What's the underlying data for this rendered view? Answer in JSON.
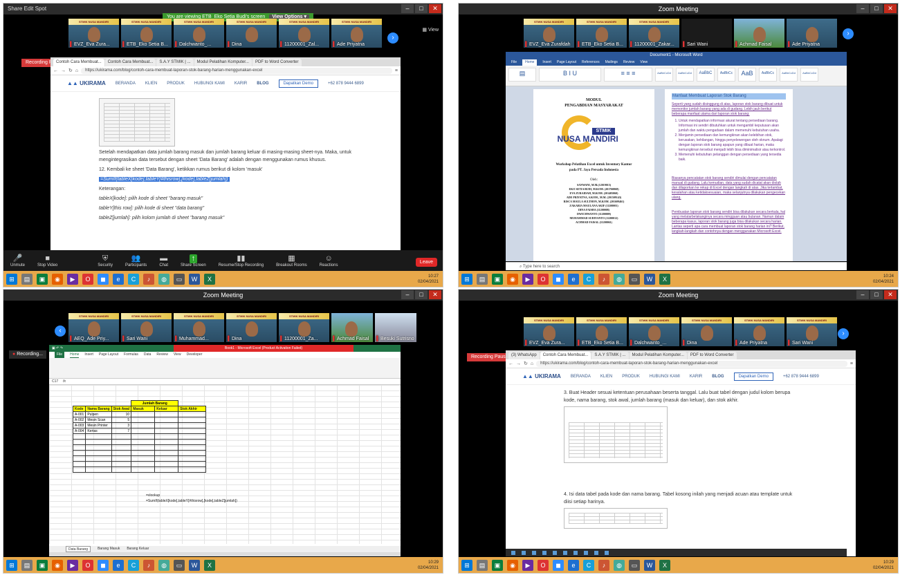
{
  "panel1": {
    "top_strip": "Share    Edit    Spot",
    "banner_text": "You are viewing ETB_Eko Setia Budi's screen",
    "view_options": "View Options ▾",
    "view_label": "View",
    "participants": [
      "EVZ_Eva Zura...",
      "ETB_Eko Setia B...",
      "Dalchwanto_...",
      "Dina",
      "11200001_Zal...",
      "Ade Priyatna"
    ],
    "recording": "Recording Paused",
    "tabs": [
      "Contoh Cara Membuat...",
      "Contoh Cara Membuat...",
      "S.A.Y STMIK | ...",
      "Modul Pelatihan Komputer...",
      "PDF to Word Converter"
    ],
    "address": "https://ukirama.com/blog/contoh-cara-membuat-laporan-stok-barang-harian-menggunakan-excel",
    "site": {
      "logo": "UKIRAMA",
      "nav": [
        "BERANDA",
        "KLIEN",
        "PRODUK",
        "HUBUNGI KAMI",
        "KARIR",
        "BLOG"
      ],
      "demo": "Dapatkan Demo",
      "phone": "+62 878 9444 6899"
    },
    "para1": "Setelah mendapatkan data jumlah barang masuk dan jumlah barang keluar di masing-masing sheet-nya. Maka, untuk mengintegrasikan data tersebut dengan sheet 'Data Barang' adalah dengan menggunakan rumus khusus.",
    "step12": "12. Kembali ke sheet 'Data Barang', ketikkan rumus berikut  di kolom 'masuk'",
    "formula": "=SumIf(tableX[kode],tableY[#thisrow],[kode],tableZ[jumlah])",
    "ket": "Keterangan:",
    "ket1": "tableX[kode]: pilih kode di sheet \"barang masuk\"",
    "ket2": "tableY[this row]: pilih kode di sheet \"data barang\"",
    "ket3": "tableZ[jumlah]: pilih kolom jumlah di sheet \"barang masuk\"",
    "controls": [
      "Unmute",
      "Stop Video",
      "Security",
      "Participants",
      "Chat",
      "Share Screen",
      "Resume/Stop Recording",
      "Breakout Rooms",
      "Reactions"
    ],
    "leave": "Leave",
    "clock": [
      "10:27",
      "02/04/2021"
    ]
  },
  "panel2": {
    "title": "Zoom Meeting",
    "participants": [
      "EVZ_Eva Zurafdah",
      "ETB_Eko Setia B...",
      "11200001_Zakar...",
      "Sari Wani",
      "Achmad Faisal",
      "Ade Priyatna"
    ],
    "doc_title": "Document1 - Microsoft Word",
    "ribbon_tabs": [
      "File",
      "Home",
      "Insert",
      "Page Layout",
      "References",
      "Mailings",
      "Review",
      "View"
    ],
    "styles": [
      "AaBbCcDd",
      "AaBbCcDd",
      "AaBbC",
      "AaBbCc",
      "AaB",
      "AaBbCc",
      "AaBbCcDd",
      "AaBbCcDd",
      "AaBbCcDd",
      "AaBbCcDd",
      "AaBbCcDd"
    ],
    "page1": {
      "h1": "MODUL",
      "h2": "PENGABDIAN MASYARAKAT",
      "stmik": "STMIK",
      "nusa": "NUSA MANDIRI",
      "workshop": "Workshop Pelatihan Excel untuk Inventory Kantor",
      "pada": "pada PT. Jaya Persada Indonesia",
      "oleh": "Oleh:",
      "names": [
        "SANWANI, M.M.(12019015)",
        "EKO SETIA BUDI, M.KOM. (201760068)",
        "EVA ZURAIDAH, M.KOM. (201405060)",
        "ADE PRIYATNA, S.KOM., M.M. (201509143)",
        "RISCA MAULA SULTHON, M.KOM. (201609461)",
        "ZAKARIA MAULANA AKIF (11200001)",
        "DINA FAISHA (11200008)",
        "DWICHWANTO (11200009)",
        "MUHAMMAD SUDIYANTO (11200012)",
        "ACHMAD FAISAL (11200061)"
      ]
    },
    "page2": {
      "heading": "Manfaat Membuat Laporan Stok Barang",
      "intro": "Seperti yang sudah disinggung di atas, laporan stok barang dibuat untuk memonitor jumlah barang yang ada di gudang. Lebih jauh berikut beberapa manfaat utama dari laporan stok barang:",
      "items": [
        "Untuk mendapatkan informasi akurat tentang persediaan barang. Informasi ini sendiri dibutuhkan untuk mengambil keputusan akan jumlah dan waktu pengadaan dalam memenuhi kebutuhan usaha.",
        "Menjamin persediaan dan kemungkinan akan kelebihan stok, kerusakan, kehilangan, hingga penyelewengan oleh oknum. Apalagi dengan laporan stok barang apapun yang dibuat harian, maka kemungkinan tersebut menjadi lebih bisa diminimalisir atau terkontrol.",
        "Memenuhi kebutuhan pelanggan dengan persediaan yang tersedia baik."
      ],
      "p2": "Biasanya pencatatan stok barang sendiri dimulai dengan pencatatan manual di gudang. Lalu kemudian, data yang sudah dicatat akan diolah dan dilaporkan ke rekap di Excel dengan langkah di atas. Jika terlambat, kesalahan atau ketidaksesuaian, maka selanjutnya dilakukan pengecekan ulang.",
      "p3": "Pembuatan laporan stok barang sendiri bisa dilakukan secara berkala, hal yang melatarbelakanginya secara mingguan atau bulanan. Namun dalam beberapa kasus, laporan stok barang juga bisa dilakukan secara harian. Lantas seperti apa cara membuat laporan stok barang harian ini? Berikut, langkah-langkah dan contohnya dengan menggunakan Microsoft Excel."
    },
    "search": "Type here to search",
    "clock": [
      "10:24",
      "02/04/2021"
    ]
  },
  "panel3": {
    "title": "Zoom Meeting",
    "participants": [
      "AEQ_Ade Priy...",
      "Sari Wani",
      "Muhammad...",
      "Dina",
      "11200001_Za...",
      "Achmad Faisal",
      "Besuki Sutrisno"
    ],
    "recording": "Recording...",
    "excel_title": "Book1 - Microsoft Excel (Product Activation Failed)",
    "tabs": [
      "File",
      "Home",
      "Insert",
      "Page Layout",
      "Formulas",
      "Data",
      "Review",
      "View",
      "Developer"
    ],
    "name_box": "C17",
    "fx": "fx",
    "columns": [
      "A",
      "B",
      "C",
      "D",
      "E",
      "F",
      "G",
      "H",
      "I",
      "J",
      "K",
      "L",
      "M",
      "N",
      "O",
      "P",
      "Q"
    ],
    "table_header": [
      "Kode",
      "Nama Barang",
      "Stok Awal",
      "Masuk",
      "Keluar",
      "Stok Akhir"
    ],
    "jumlah": "Jumlah Barang",
    "rows": [
      [
        "A-001",
        "Pulpen",
        "10"
      ],
      [
        "A-002",
        "Mesin Scan",
        "5"
      ],
      [
        "A-003",
        "Mesin Printer",
        "3"
      ],
      [
        "A-004",
        "Kertas",
        "7"
      ]
    ],
    "formula_label": "=vlookup",
    "formula": "=SumIf(tableX[kode],tableY[#thisrow],[kode],tableZ[jumlah])",
    "sheets": [
      "Data Barang",
      "Barang Masuk",
      "Barang Keluar"
    ],
    "clock": [
      "10:29",
      "02/04/2021"
    ]
  },
  "panel4": {
    "title": "Zoom Meeting",
    "participants": [
      "EVZ_Eva Zura...",
      "ETB_Eko Setia B...",
      "Dalchwanto_...",
      "Dina",
      "Ade Priyatna",
      "Sari Wani"
    ],
    "recording": "Recording Paused",
    "tabs": [
      "(3) WhatsApp",
      "Contoh Cara Membuat...",
      "S.A.Y STMIK | ...",
      "Modul Pelatihan Komputer...",
      "PDF to Word Converter"
    ],
    "address": "https://ukirama.com/blog/contoh-cara-membuat-laporan-stok-barang-harian-menggunakan-excel",
    "site": {
      "logo": "UKIRAMA",
      "nav": [
        "BERANDA",
        "KLIEN",
        "PRODUK",
        "HUBUNGI KAMI",
        "KARIR",
        "BLOG"
      ],
      "demo": "Dapatkan Demo",
      "phone": "+62 878 9444 6899"
    },
    "step3": "3. Buat Header sesuai ketentuan perusahaan beserta tanggal. Lalu buat tabel dengan judul kolom berupa kode, nama barang, stok awal, jumlah barang (masuk dan keluar), dan stok akhir.",
    "step4": "4. Isi data tabel pada kode dan nama barang. Tabel kosong inilah yang menjadi acuan atau template untuk diisi setiap harinya.",
    "clock": [
      "10:29",
      "02/04/2021"
    ]
  },
  "colors": {
    "zoom_blue": "#2d8cff",
    "record_red": "#d63a3a",
    "taskbar": "#e8a84a",
    "word_blue": "#2b579a",
    "excel_green": "#1f7244",
    "highlight": "#ffff00"
  }
}
